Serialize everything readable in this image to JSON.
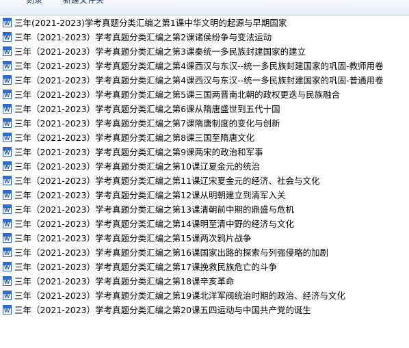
{
  "toolbar": {
    "burn_label": "刻录",
    "new_folder_label": "新建文件夹"
  },
  "files": [
    {
      "name": "三年(2021-2023)学考真题分类汇编之第1课中华文明的起源与早期国家",
      "icon": "word-doc-icon"
    },
    {
      "name": "三年（2021-2023）学考真题分类汇编之第2课诸侯纷争与变法运动",
      "icon": "word-doc-icon"
    },
    {
      "name": "三年（2021-2023）学考真题分类汇编之第3课秦统一多民族封建国家的建立",
      "icon": "word-doc-icon"
    },
    {
      "name": "三年（2021-2023）学考真题分类汇编之第4课西汉与东汉--统一多民族封建国家的巩固-教师用卷",
      "icon": "word-doc-icon"
    },
    {
      "name": "三年（2021-2023）学考真题分类汇编之第4课西汉与东汉--统一多民族封建国家的巩固-普通用卷",
      "icon": "word-doc-icon"
    },
    {
      "name": "三年（2021-2023）学考真题分类汇编之第5课三国两晋南北朝的政权更迭与民族融合",
      "icon": "word-doc-icon"
    },
    {
      "name": "三年（2021-2023）学考真题分类汇编之第6课从隋唐盛世到五代十国",
      "icon": "word-doc-icon"
    },
    {
      "name": "三年（2021-2023）学考真题分类汇编之第7课隋唐制度的变化与创新",
      "icon": "word-doc-icon"
    },
    {
      "name": "三年（2021-2023）学考真题分类汇编之第8课三国至隋唐文化",
      "icon": "word-doc-icon"
    },
    {
      "name": "三年（2021-2023）学考真题分类汇编之第9课两宋的政治和军事",
      "icon": "word-doc-icon"
    },
    {
      "name": "三年（2021-2023）学考真题分类汇编之第10课辽夏金元的统治",
      "icon": "word-doc-icon"
    },
    {
      "name": "三年（2021-2023）学考真题分类汇编之第11课辽宋夏金元的经济、社会与文化",
      "icon": "word-doc-icon"
    },
    {
      "name": "三年（2021-2023）学考真题分类汇编之第12课从明朝建立到清军入关",
      "icon": "word-doc-icon"
    },
    {
      "name": "三年（2021-2023）学考真题分类汇编之第13课清朝前中期的鼎盛与危机",
      "icon": "word-doc-icon"
    },
    {
      "name": "三年（2021-2023）学考真题分类汇编之第14课明至清中野的经济与文化",
      "icon": "word-doc-icon"
    },
    {
      "name": "三年（2021-2023）学考真题分类汇编之第15课两次鸦片战争",
      "icon": "word-doc-icon"
    },
    {
      "name": "三年（2021-2023）学考真题分类汇编之第16课国家出路的探索与列强侵略的加剧",
      "icon": "word-doc-icon"
    },
    {
      "name": "三年（2021-2023）学考真题分类汇编之第17课挽救民族危亡的斗争",
      "icon": "word-doc-icon"
    },
    {
      "name": "三年（2021-2023）学考真题分类汇编之第18课辛亥革命",
      "icon": "word-doc-icon"
    },
    {
      "name": "三年（2021-2023）学考真题分类汇编之第19课北洋军阀统治时期的政治、经济与文化",
      "icon": "word-doc-icon"
    },
    {
      "name": "三年（2021-2023）学考真题分类汇编之第20课五四运动与中国共产党的诞生",
      "icon": "word-doc-icon"
    }
  ]
}
